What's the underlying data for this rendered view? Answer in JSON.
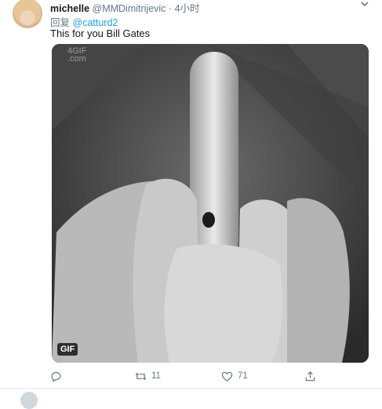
{
  "tweet": {
    "display_name": "michelle",
    "handle": "@MMDimitrijevic",
    "separator": "·",
    "time": "4小时",
    "reply_prefix": "回复",
    "reply_mention": "@catturd2",
    "text": "This for you Bill Gates",
    "media": {
      "watermark": "4GIF\n.com",
      "badge": "GIF"
    },
    "actions": {
      "reply_count": "",
      "retweet_count": "11",
      "like_count": "71",
      "share_count": ""
    }
  },
  "icons": {
    "more": "chevron-down-icon",
    "reply": "reply-icon",
    "retweet": "retweet-icon",
    "like": "heart-icon",
    "share": "share-icon"
  },
  "colors": {
    "accent": "#1da1f2",
    "muted": "#657786",
    "divider": "#e6ecf0"
  }
}
